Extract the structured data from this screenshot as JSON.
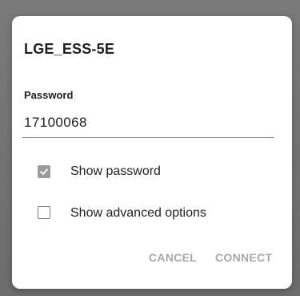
{
  "dialog": {
    "title": "LGE_ESS-5E",
    "password_label": "Password",
    "password_value": "17100068",
    "show_password": {
      "label": "Show password",
      "checked": true
    },
    "show_advanced": {
      "label": "Show advanced options",
      "checked": false
    },
    "actions": {
      "cancel_label": "CANCEL",
      "connect_label": "CONNECT"
    }
  },
  "colors": {
    "overlay": "#6f6f6f",
    "surface": "#ffffff",
    "text": "#222222",
    "checkbox_checked": "#9a9a9a",
    "action_text": "#a8a8a8"
  }
}
